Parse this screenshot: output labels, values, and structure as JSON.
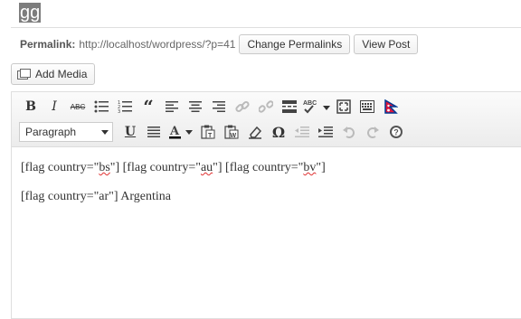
{
  "post_title": "gg",
  "permalink": {
    "label": "Permalink:",
    "url": "http://localhost/wordpress/?p=41",
    "change_button": "Change Permalinks",
    "view_button": "View Post"
  },
  "add_media_label": "Add Media",
  "toolbar": {
    "row1": [
      "bold-icon",
      "italic-icon",
      "strikethrough-icon",
      "bullet-list-icon",
      "numbered-list-icon",
      "blockquote-icon",
      "align-left-icon",
      "align-center-icon",
      "align-right-icon",
      "link-icon",
      "unlink-icon",
      "read-more-icon",
      "spellcheck-icon",
      "fullscreen-icon",
      "kitchen-sink-icon",
      "flag-icon"
    ],
    "format_select_value": "Paragraph",
    "row2": [
      "underline-icon",
      "justify-icon",
      "text-color-icon",
      "paste-text-icon",
      "paste-word-icon",
      "clear-format-icon",
      "special-char-icon",
      "outdent-icon",
      "indent-icon",
      "undo-icon",
      "redo-icon",
      "help-icon"
    ]
  },
  "content": {
    "line1": {
      "p1": "[flag country=\"",
      "c1": "bs",
      "p2": "\"] [flag country=\"",
      "c2": "au",
      "p3": "\"] [flag country=\"",
      "c3": "bv",
      "p4": "\"]"
    },
    "line2": "[flag country=\"ar\"] Argentina"
  }
}
